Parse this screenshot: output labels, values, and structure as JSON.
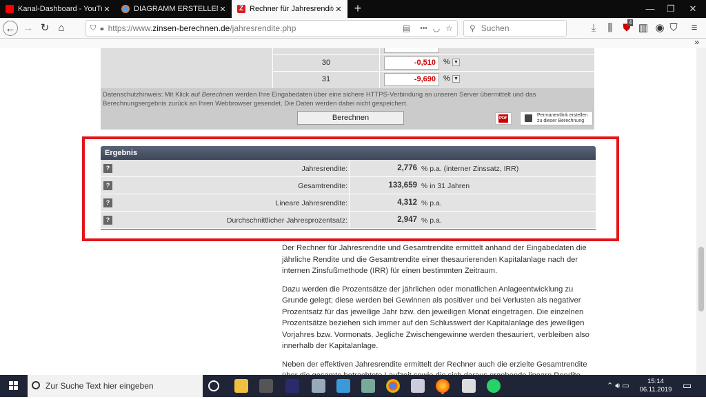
{
  "browser": {
    "tabs": [
      {
        "title": "Kanal-Dashboard - YouTube St",
        "icon": "youtube-icon",
        "active": false
      },
      {
        "title": "DIAGRAMM ERSTELLEN | Erzeu",
        "icon": "firefox-icon",
        "active": false
      },
      {
        "title": "Rechner für Jahresrendite und G",
        "icon": "zinsen-z-icon",
        "active": true
      }
    ],
    "new_tab": "+",
    "url_prefix": "https://www.",
    "url_domain": "zinsen-berechnen.de",
    "url_path": "/jahresrendite.php",
    "search_placeholder": "Suchen",
    "ublock_count": "4",
    "menu_dots": "•••"
  },
  "calculator": {
    "rows": [
      {
        "year": "",
        "value": "",
        "unit": "%"
      },
      {
        "year": "30",
        "value": "-0,510",
        "unit": "%"
      },
      {
        "year": "31",
        "value": "-9,690",
        "unit": "%"
      }
    ],
    "privacy_prefix": "Datenschutzhinweis: Mit Klick auf ",
    "privacy_em": "Berechnen",
    "privacy_suffix": " werden Ihre Eingabedaten über eine sichere HTTPS-Verbindung an unseren Server übermittelt und das Berechnungsergebnis zurück an Ihren Webbrowser gesendet. Die Daten werden dabei nicht gespeichert.",
    "calc_button": "Berechnen",
    "pdf_label": "PDF",
    "permalink_line1": "Permanentlink erstellen",
    "permalink_line2": "zu dieser Berechnung"
  },
  "result": {
    "heading": "Ergebnis",
    "help": "?",
    "rows": [
      {
        "label": "Jahresrendite:",
        "value": "2,776",
        "unit": "% p.a. (interner Zinssatz, IRR)"
      },
      {
        "label": "Gesamtrendite:",
        "value": "133,659",
        "unit": "% in 31 Jahren"
      },
      {
        "label": "Lineare Jahresrendite:",
        "value": "4,312",
        "unit": "% p.a."
      },
      {
        "label": "Durchschnittlicher Jahresprozentsatz:",
        "value": "2,947",
        "unit": "% p.a."
      }
    ]
  },
  "article": {
    "p1": "Der Rechner für Jahresrendite und Gesamtrendite ermittelt anhand der Eingabedaten die jährliche Rendite und die Gesamtrendite einer thesaurierenden Kapitalanlage nach der internen Zinsfußmethode (IRR) für einen bestimmten Zeitraum.",
    "p2": "Dazu werden die Prozentsätze der jährlichen oder monatlichen Anlageentwicklung zu Grunde gelegt; diese werden bei Gewinnen als positiver und bei Verlusten als negativer Prozentsatz für das jeweilige Jahr bzw. den jeweiligen Monat eingetragen. Die einzelnen Prozentsätze beziehen sich immer auf den Schlusswert der Kapitalanlage des jeweiligen Vorjahres bzw. Vormonats. Jegliche Zwischengewinne werden thesauriert, verbleiben also innerhalb der Kapitalanlage.",
    "p3": "Neben der effektiven Jahresrendite ermittelt der Rechner auch die erzielte Gesamtrendite über die gesamte betrachtete Laufzeit sowie die sich daraus ergebende lineare Rendite, bezogen auf den Anfangswert der Kapitalanlage."
  },
  "taskbar": {
    "search_placeholder": "Zur Suche Text hier eingeben",
    "time": "15:14",
    "date": "06.11.2019"
  },
  "colors": {
    "highlight_border": "#e5141b",
    "negative_value": "#cc0000",
    "result_header": "#4a5266"
  }
}
